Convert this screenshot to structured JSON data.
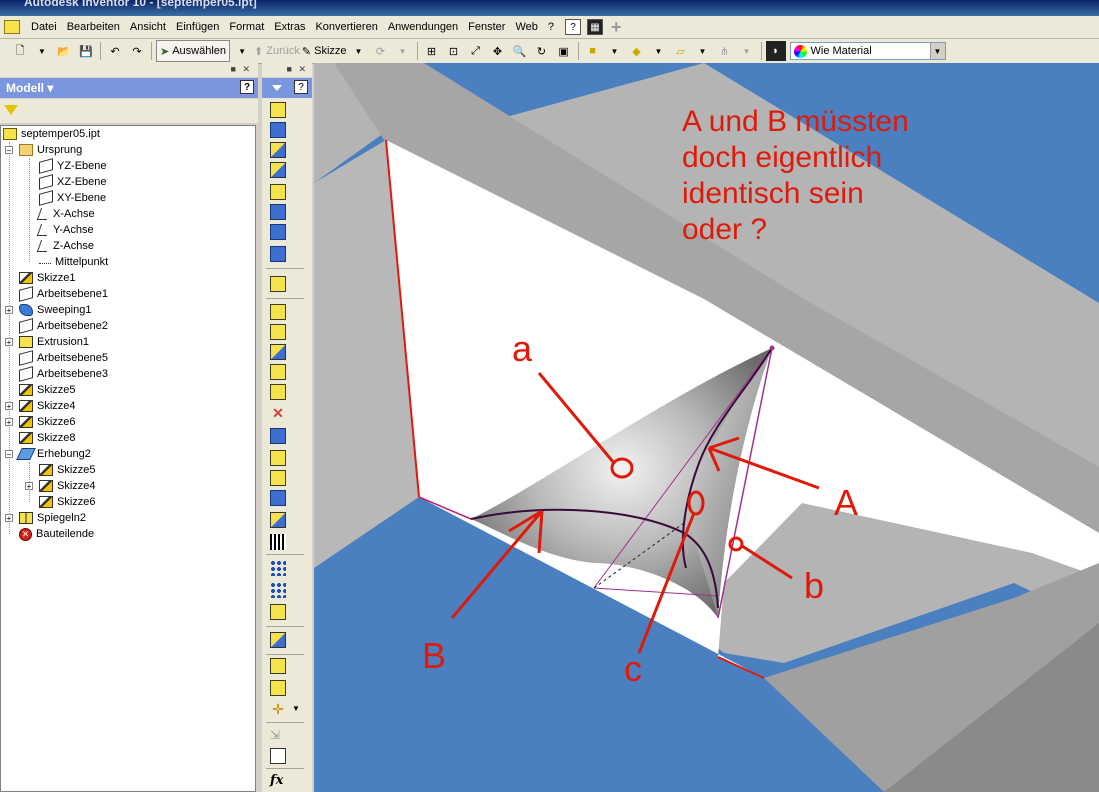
{
  "window": {
    "title": "Autodesk Inventor 10 - [septemper05.ipt]"
  },
  "menu": {
    "items": [
      "Datei",
      "Bearbeiten",
      "Ansicht",
      "Einfügen",
      "Format",
      "Extras",
      "Konvertieren",
      "Anwendungen",
      "Fenster",
      "Web",
      "?"
    ]
  },
  "toolbar": {
    "select_label": "Auswählen",
    "back_label": "Zurück",
    "sketch_label": "Skizze",
    "material_value": "Wie Material"
  },
  "browser": {
    "title": "Modell",
    "help": "?",
    "root": "septemper05.ipt",
    "items": [
      "Ursprung",
      "YZ-Ebene",
      "XZ-Ebene",
      "XY-Ebene",
      "X-Achse",
      "Y-Achse",
      "Z-Achse",
      "Mittelpunkt",
      "Skizze1",
      "Arbeitsebene1",
      "Sweeping1",
      "Arbeitsebene2",
      "Extrusion1",
      "Arbeitsebene5",
      "Arbeitsebene3",
      "Skizze5",
      "Skizze4",
      "Skizze6",
      "Skizze8",
      "Erhebung2",
      "Skizze5",
      "Skizze4",
      "Skizze6",
      "Spiegeln2",
      "Bauteilende"
    ]
  },
  "palette": {
    "help": "?",
    "fx_label": "fx"
  },
  "annotation": {
    "question_lines": [
      "A und B müssten",
      "doch eigentlich",
      "identisch sein",
      "oder ?"
    ],
    "label_a_lower": "a",
    "label_A_upper": "A",
    "label_B": "B",
    "label_b": "b",
    "label_c": "c",
    "color": "#e01a0a"
  },
  "colors": {
    "model_blue": "#4a7fc0",
    "browser_header": "#7a96df",
    "edge_red": "#e01a0a",
    "edge_purple": "#a03090"
  }
}
